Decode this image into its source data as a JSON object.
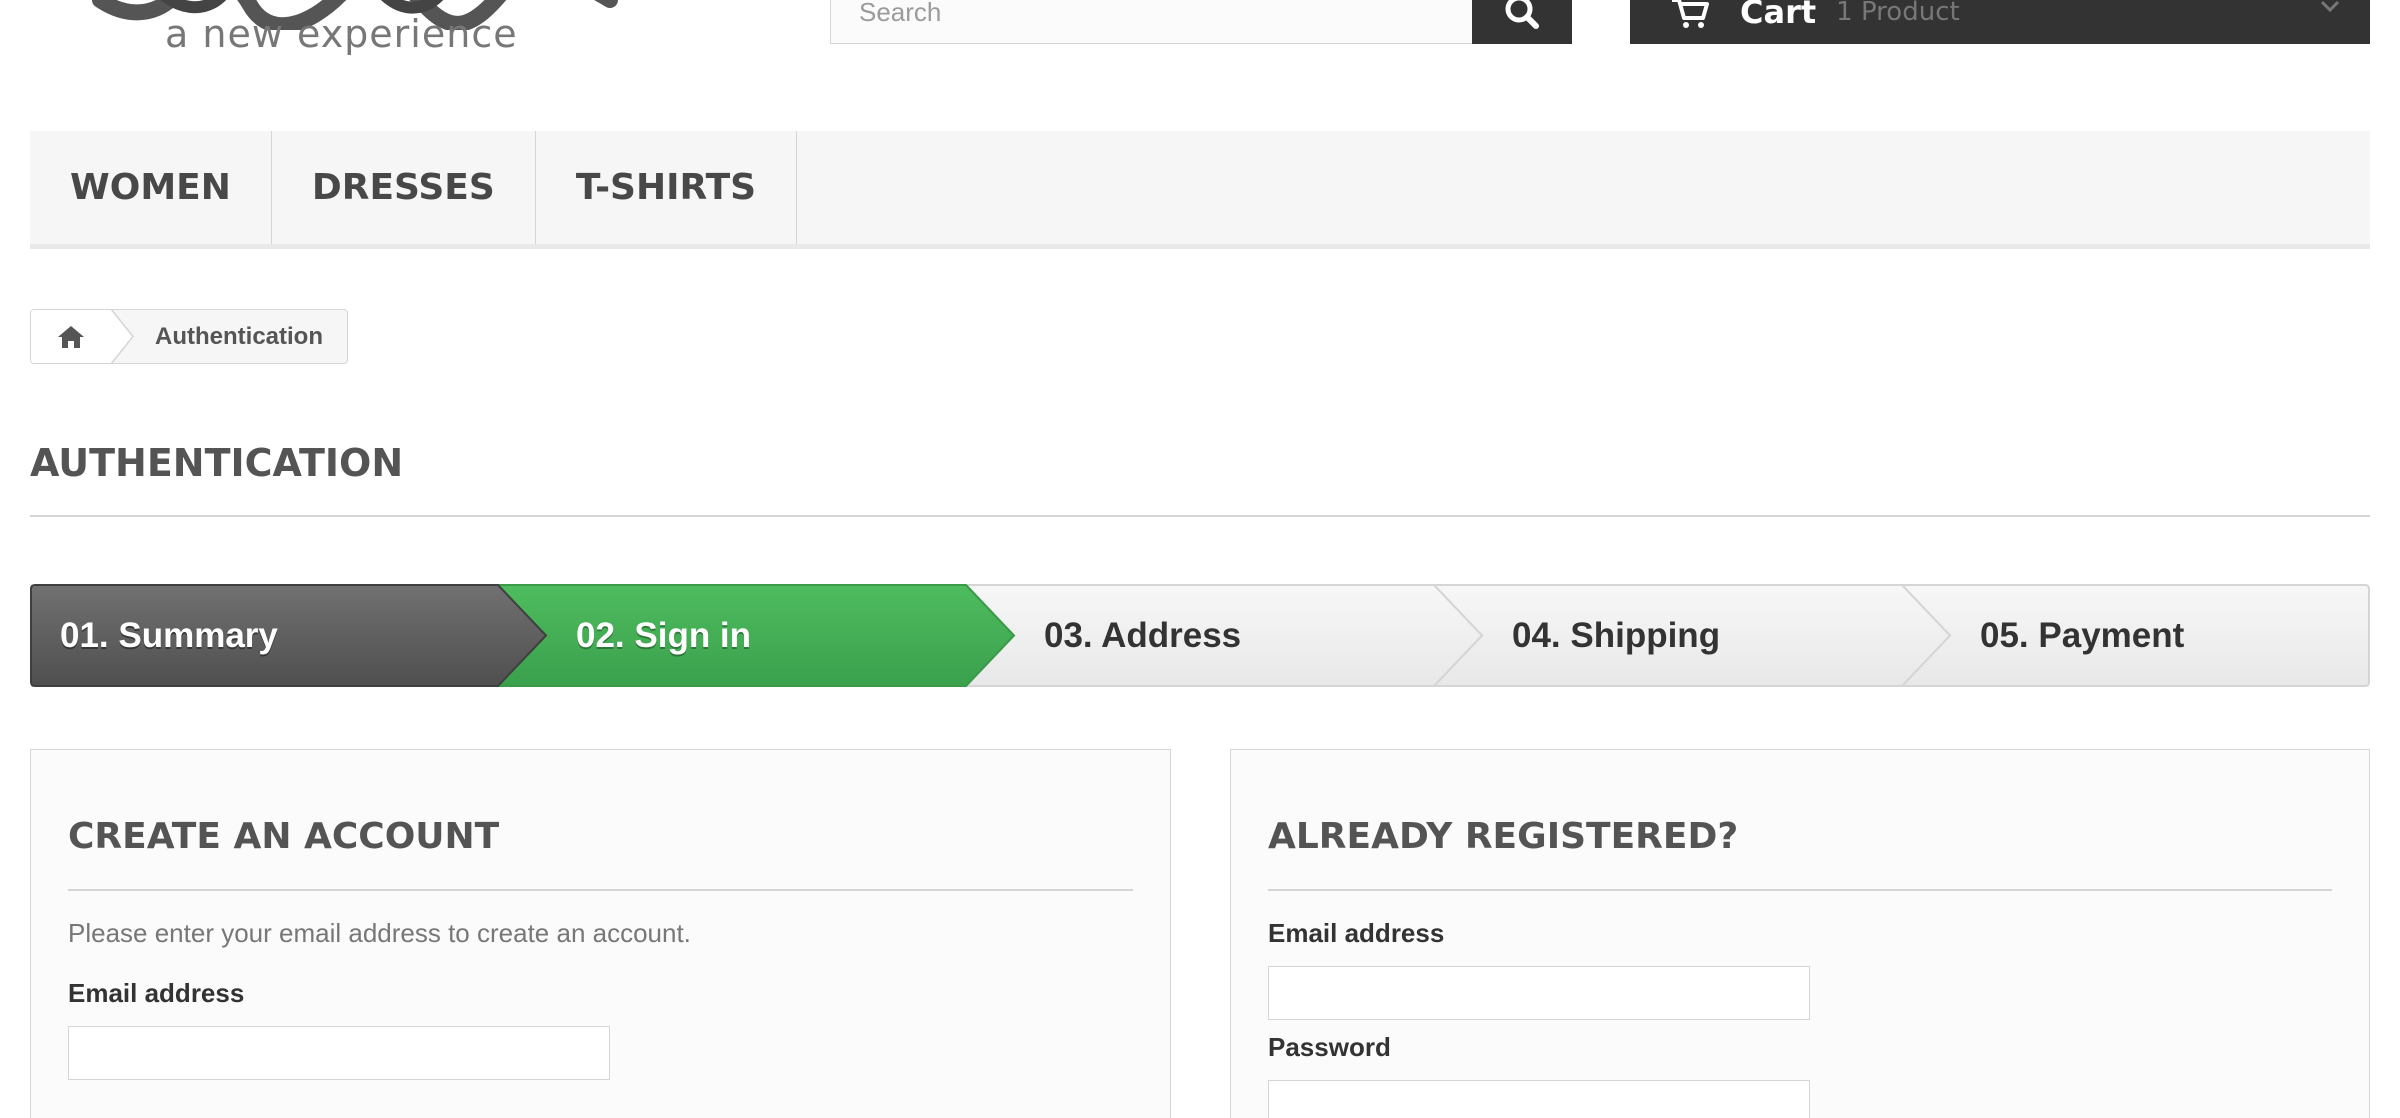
{
  "header": {
    "logo_script": "yourLogo",
    "logo_tagline": "a new experience",
    "search_placeholder": "Search",
    "search_icon": "search-icon",
    "cart_icon": "shopping-cart-icon",
    "cart_title": "Cart",
    "cart_quantity": "1 Product",
    "cart_chevron_icon": "chevron-down-icon"
  },
  "menu": {
    "items": [
      {
        "label": "WOMEN"
      },
      {
        "label": "DRESSES"
      },
      {
        "label": "T-SHIRTS"
      }
    ]
  },
  "breadcrumb": {
    "home_icon": "home-icon",
    "current": "Authentication"
  },
  "page_heading": "AUTHENTICATION",
  "steps": {
    "items": [
      {
        "label": "01. Summary",
        "state": "done"
      },
      {
        "label": "02. Sign in",
        "state": "current"
      },
      {
        "label": "03. Address",
        "state": "todo"
      },
      {
        "label": "04. Shipping",
        "state": "todo"
      },
      {
        "label": "05. Payment",
        "state": "todo"
      }
    ],
    "colors": {
      "done": "#5f5f5f",
      "current": "#45b055",
      "todo": "#f0f0f0"
    }
  },
  "create_account": {
    "title": "CREATE AN ACCOUNT",
    "intro": "Please enter your email address to create an account.",
    "email_label": "Email address",
    "email_value": ""
  },
  "login": {
    "title": "ALREADY REGISTERED?",
    "email_label": "Email address",
    "email_value": "",
    "password_label": "Password",
    "password_value": ""
  }
}
